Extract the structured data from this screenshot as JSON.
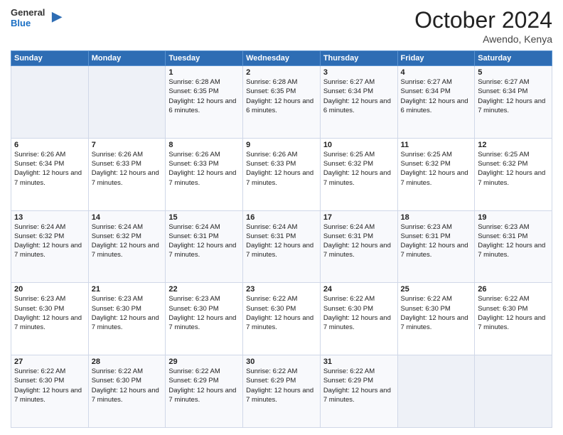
{
  "header": {
    "logo_line1": "General",
    "logo_line2": "Blue",
    "month": "October 2024",
    "location": "Awendo, Kenya"
  },
  "weekdays": [
    "Sunday",
    "Monday",
    "Tuesday",
    "Wednesday",
    "Thursday",
    "Friday",
    "Saturday"
  ],
  "weeks": [
    [
      {
        "day": "",
        "empty": true
      },
      {
        "day": "",
        "empty": true
      },
      {
        "day": "1",
        "sunrise": "6:28 AM",
        "sunset": "6:35 PM",
        "daylight": "12 hours and 6 minutes."
      },
      {
        "day": "2",
        "sunrise": "6:28 AM",
        "sunset": "6:35 PM",
        "daylight": "12 hours and 6 minutes."
      },
      {
        "day": "3",
        "sunrise": "6:27 AM",
        "sunset": "6:34 PM",
        "daylight": "12 hours and 6 minutes."
      },
      {
        "day": "4",
        "sunrise": "6:27 AM",
        "sunset": "6:34 PM",
        "daylight": "12 hours and 6 minutes."
      },
      {
        "day": "5",
        "sunrise": "6:27 AM",
        "sunset": "6:34 PM",
        "daylight": "12 hours and 7 minutes."
      }
    ],
    [
      {
        "day": "6",
        "sunrise": "6:26 AM",
        "sunset": "6:34 PM",
        "daylight": "12 hours and 7 minutes."
      },
      {
        "day": "7",
        "sunrise": "6:26 AM",
        "sunset": "6:33 PM",
        "daylight": "12 hours and 7 minutes."
      },
      {
        "day": "8",
        "sunrise": "6:26 AM",
        "sunset": "6:33 PM",
        "daylight": "12 hours and 7 minutes."
      },
      {
        "day": "9",
        "sunrise": "6:26 AM",
        "sunset": "6:33 PM",
        "daylight": "12 hours and 7 minutes."
      },
      {
        "day": "10",
        "sunrise": "6:25 AM",
        "sunset": "6:32 PM",
        "daylight": "12 hours and 7 minutes."
      },
      {
        "day": "11",
        "sunrise": "6:25 AM",
        "sunset": "6:32 PM",
        "daylight": "12 hours and 7 minutes."
      },
      {
        "day": "12",
        "sunrise": "6:25 AM",
        "sunset": "6:32 PM",
        "daylight": "12 hours and 7 minutes."
      }
    ],
    [
      {
        "day": "13",
        "sunrise": "6:24 AM",
        "sunset": "6:32 PM",
        "daylight": "12 hours and 7 minutes."
      },
      {
        "day": "14",
        "sunrise": "6:24 AM",
        "sunset": "6:32 PM",
        "daylight": "12 hours and 7 minutes."
      },
      {
        "day": "15",
        "sunrise": "6:24 AM",
        "sunset": "6:31 PM",
        "daylight": "12 hours and 7 minutes."
      },
      {
        "day": "16",
        "sunrise": "6:24 AM",
        "sunset": "6:31 PM",
        "daylight": "12 hours and 7 minutes."
      },
      {
        "day": "17",
        "sunrise": "6:24 AM",
        "sunset": "6:31 PM",
        "daylight": "12 hours and 7 minutes."
      },
      {
        "day": "18",
        "sunrise": "6:23 AM",
        "sunset": "6:31 PM",
        "daylight": "12 hours and 7 minutes."
      },
      {
        "day": "19",
        "sunrise": "6:23 AM",
        "sunset": "6:31 PM",
        "daylight": "12 hours and 7 minutes."
      }
    ],
    [
      {
        "day": "20",
        "sunrise": "6:23 AM",
        "sunset": "6:30 PM",
        "daylight": "12 hours and 7 minutes."
      },
      {
        "day": "21",
        "sunrise": "6:23 AM",
        "sunset": "6:30 PM",
        "daylight": "12 hours and 7 minutes."
      },
      {
        "day": "22",
        "sunrise": "6:23 AM",
        "sunset": "6:30 PM",
        "daylight": "12 hours and 7 minutes."
      },
      {
        "day": "23",
        "sunrise": "6:22 AM",
        "sunset": "6:30 PM",
        "daylight": "12 hours and 7 minutes."
      },
      {
        "day": "24",
        "sunrise": "6:22 AM",
        "sunset": "6:30 PM",
        "daylight": "12 hours and 7 minutes."
      },
      {
        "day": "25",
        "sunrise": "6:22 AM",
        "sunset": "6:30 PM",
        "daylight": "12 hours and 7 minutes."
      },
      {
        "day": "26",
        "sunrise": "6:22 AM",
        "sunset": "6:30 PM",
        "daylight": "12 hours and 7 minutes."
      }
    ],
    [
      {
        "day": "27",
        "sunrise": "6:22 AM",
        "sunset": "6:30 PM",
        "daylight": "12 hours and 7 minutes."
      },
      {
        "day": "28",
        "sunrise": "6:22 AM",
        "sunset": "6:30 PM",
        "daylight": "12 hours and 7 minutes."
      },
      {
        "day": "29",
        "sunrise": "6:22 AM",
        "sunset": "6:29 PM",
        "daylight": "12 hours and 7 minutes."
      },
      {
        "day": "30",
        "sunrise": "6:22 AM",
        "sunset": "6:29 PM",
        "daylight": "12 hours and 7 minutes."
      },
      {
        "day": "31",
        "sunrise": "6:22 AM",
        "sunset": "6:29 PM",
        "daylight": "12 hours and 7 minutes."
      },
      {
        "day": "",
        "empty": true
      },
      {
        "day": "",
        "empty": true
      }
    ]
  ]
}
